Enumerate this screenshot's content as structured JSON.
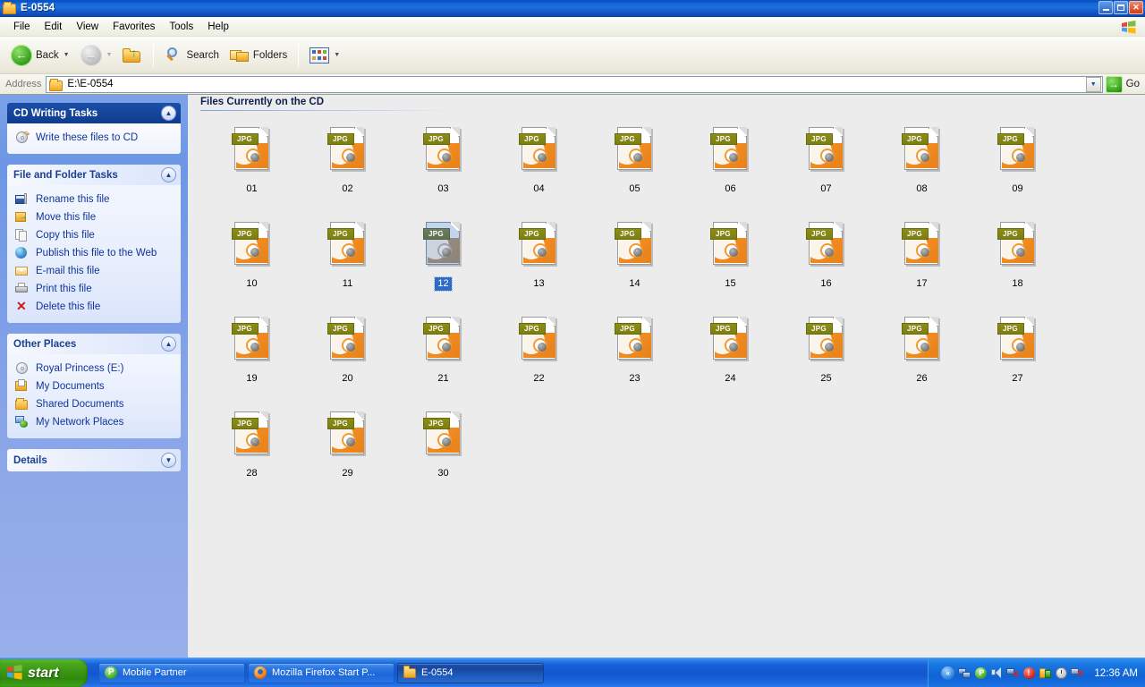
{
  "window": {
    "title": "E-0554",
    "title_icon": "folder-icon",
    "buttons": {
      "minimize": "_",
      "maximize": "❐",
      "close": "✕"
    }
  },
  "menubar": {
    "items": [
      {
        "label": "File"
      },
      {
        "label": "Edit"
      },
      {
        "label": "View"
      },
      {
        "label": "Favorites"
      },
      {
        "label": "Tools"
      },
      {
        "label": "Help"
      }
    ],
    "logo": "windows-flag-icon"
  },
  "toolbar": {
    "back_label": "Back",
    "back_icon": "back-arrow-icon",
    "forward_icon": "forward-arrow-icon",
    "up_icon": "up-folder-icon",
    "search_label": "Search",
    "search_icon": "magnifier-icon",
    "folders_label": "Folders",
    "folders_icon": "folders-icon",
    "views_icon": "views-icon",
    "dropdown_caret": "▼"
  },
  "address": {
    "label": "Address",
    "value": "E:\\E-0554",
    "icon": "folder-icon",
    "dropdown_caret": "▼",
    "go_label": "Go",
    "go_icon": "go-arrow-icon"
  },
  "sidebar": {
    "panels": [
      {
        "id": "cd-writing-tasks",
        "title": "CD Writing Tasks",
        "style": "dark",
        "chevron": "▲",
        "items": [
          {
            "label": "Write these files to CD",
            "icon": "burn-cd-icon"
          }
        ]
      },
      {
        "id": "file-and-folder-tasks",
        "title": "File and Folder Tasks",
        "style": "light",
        "chevron": "▲",
        "items": [
          {
            "label": "Rename this file",
            "icon": "rename-icon"
          },
          {
            "label": "Move this file",
            "icon": "move-icon"
          },
          {
            "label": "Copy this file",
            "icon": "copy-icon"
          },
          {
            "label": "Publish this file to the Web",
            "icon": "publish-web-icon"
          },
          {
            "label": "E-mail this file",
            "icon": "email-icon"
          },
          {
            "label": "Print this file",
            "icon": "printer-icon"
          },
          {
            "label": "Delete this file",
            "icon": "delete-x-icon"
          }
        ]
      },
      {
        "id": "other-places",
        "title": "Other Places",
        "style": "light",
        "chevron": "▲",
        "items": [
          {
            "label": "Royal Princess (E:)",
            "icon": "cd-drive-icon"
          },
          {
            "label": "My Documents",
            "icon": "my-documents-icon"
          },
          {
            "label": "Shared Documents",
            "icon": "shared-folder-icon"
          },
          {
            "label": "My Network Places",
            "icon": "network-places-icon"
          }
        ]
      },
      {
        "id": "details",
        "title": "Details",
        "style": "light",
        "chevron": "▼",
        "collapsed": true,
        "items": []
      }
    ]
  },
  "content": {
    "group_title": "Files Currently on the CD",
    "file_type_badge": "JPG",
    "files": [
      {
        "name": "01",
        "selected": false
      },
      {
        "name": "02",
        "selected": false
      },
      {
        "name": "03",
        "selected": false
      },
      {
        "name": "04",
        "selected": false
      },
      {
        "name": "05",
        "selected": false
      },
      {
        "name": "06",
        "selected": false
      },
      {
        "name": "07",
        "selected": false
      },
      {
        "name": "08",
        "selected": false
      },
      {
        "name": "09",
        "selected": false
      },
      {
        "name": "10",
        "selected": false
      },
      {
        "name": "11",
        "selected": false
      },
      {
        "name": "12",
        "selected": true
      },
      {
        "name": "13",
        "selected": false
      },
      {
        "name": "14",
        "selected": false
      },
      {
        "name": "15",
        "selected": false
      },
      {
        "name": "16",
        "selected": false
      },
      {
        "name": "17",
        "selected": false
      },
      {
        "name": "18",
        "selected": false
      },
      {
        "name": "19",
        "selected": false
      },
      {
        "name": "20",
        "selected": false
      },
      {
        "name": "21",
        "selected": false
      },
      {
        "name": "22",
        "selected": false
      },
      {
        "name": "23",
        "selected": false
      },
      {
        "name": "24",
        "selected": false
      },
      {
        "name": "25",
        "selected": false
      },
      {
        "name": "26",
        "selected": false
      },
      {
        "name": "27",
        "selected": false
      },
      {
        "name": "28",
        "selected": false
      },
      {
        "name": "29",
        "selected": false
      },
      {
        "name": "30",
        "selected": false
      }
    ]
  },
  "taskbar": {
    "start_label": "start",
    "start_icon": "windows-flag-icon",
    "tasks": [
      {
        "label": "Mobile Partner",
        "icon": "mobile-partner-icon",
        "active": false
      },
      {
        "label": "Mozilla Firefox Start P...",
        "icon": "firefox-icon",
        "active": false
      },
      {
        "label": "E-0554",
        "icon": "folder-icon",
        "active": true
      }
    ],
    "tray": {
      "handle": "«",
      "icons": [
        "network-connections-icon",
        "mobile-partner-tray-icon",
        "volume-icon",
        "network-disconnected-icon",
        "security-alert-icon",
        "update-icon",
        "clock-tray-icon",
        "network-error-icon"
      ],
      "clock": "12:36 AM"
    }
  },
  "colors": {
    "titlebar_blue": "#1463d8",
    "sidebar_blue": "#7a9ee7",
    "panel_header_dark": "#16459b",
    "selection_blue": "#316ac5",
    "content_bg": "#ececec",
    "jpg_orange": "#ef8c22",
    "jpg_badge_olive": "#7c7e12",
    "taskbar_blue": "#1257d0",
    "start_green": "#3b9614"
  }
}
